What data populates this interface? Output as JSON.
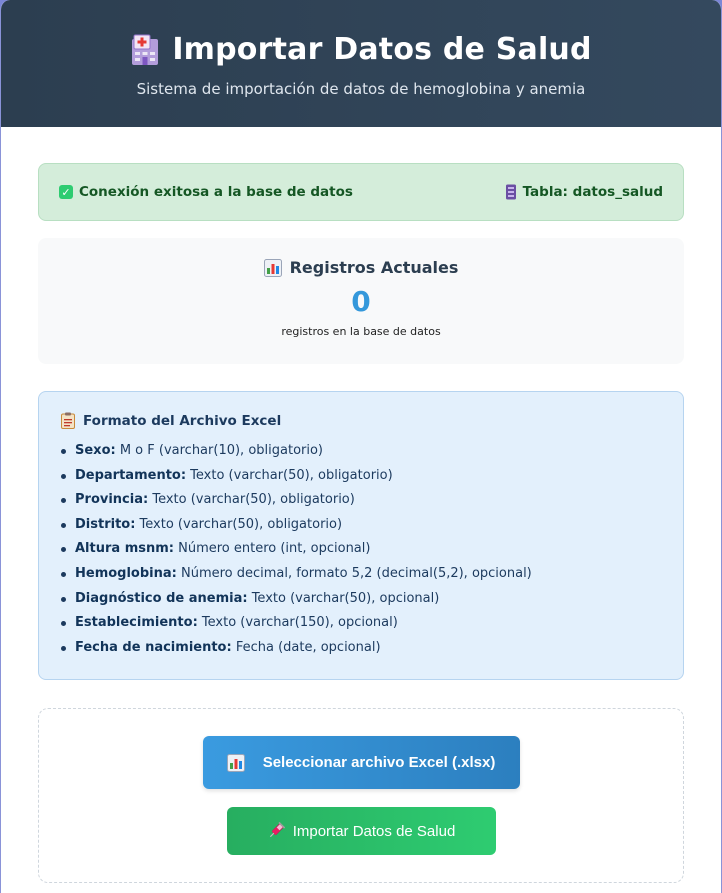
{
  "header": {
    "title": "Importar Datos de Salud",
    "subtitle": "Sistema de importación de datos de hemoglobina y anemia",
    "icon": "hospital-icon"
  },
  "connection": {
    "status": "Conexión exitosa a la base de datos",
    "table": "Tabla: datos_salud",
    "status_icon": "check-icon",
    "table_icon": "database-icon"
  },
  "records": {
    "title": "Registros Actuales",
    "count": "0",
    "description": "registros en la base de datos",
    "icon": "bar-chart-icon"
  },
  "format": {
    "title": "Formato del Archivo Excel",
    "icon": "clipboard-icon",
    "fields": [
      {
        "name": "Sexo:",
        "desc": " M o F (varchar(10), obligatorio)"
      },
      {
        "name": "Departamento:",
        "desc": " Texto (varchar(50), obligatorio)"
      },
      {
        "name": "Provincia:",
        "desc": " Texto (varchar(50), obligatorio)"
      },
      {
        "name": "Distrito:",
        "desc": " Texto (varchar(50), obligatorio)"
      },
      {
        "name": "Altura msnm:",
        "desc": " Número entero (int, opcional)"
      },
      {
        "name": "Hemoglobina:",
        "desc": " Número decimal, formato 5,2 (decimal(5,2), opcional)"
      },
      {
        "name": "Diagnóstico de anemia:",
        "desc": " Texto (varchar(50), opcional)"
      },
      {
        "name": "Establecimiento:",
        "desc": " Texto (varchar(150), opcional)"
      },
      {
        "name": "Fecha de nacimiento:",
        "desc": " Fecha (date, opcional)"
      }
    ]
  },
  "actions": {
    "select_label": "Seleccionar archivo Excel (.xlsx)",
    "import_label": "Importar Datos de Salud",
    "select_icon": "bar-chart-icon",
    "import_icon": "syringe-icon"
  },
  "colors": {
    "header_bg": "#2c3e50",
    "success_bg": "#d4edda",
    "accent_blue": "#3498db",
    "accent_green": "#27ae60"
  }
}
